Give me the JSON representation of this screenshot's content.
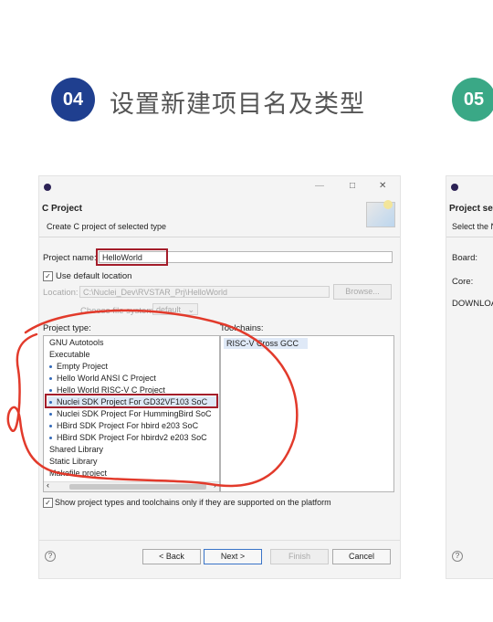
{
  "colors": {
    "step4_circle": "#1f3f8f",
    "step5_circle": "#3aa886",
    "annotation_red": "#e23a2b",
    "highlight_box": "#a41d2a"
  },
  "header": {
    "step_number": "04",
    "step_title": "设置新建项目名及类型",
    "next_step_number": "05"
  },
  "dialog": {
    "app_icon": "eclipse-icon",
    "window_controls": [
      "—",
      "□",
      "✕"
    ],
    "title": "C Project",
    "subtitle": "Create C project of selected type",
    "project_name_label": "Project name:",
    "project_name_value": "HelloWorld",
    "use_default_location_label": "Use default location",
    "use_default_location_checked": true,
    "location_label": "Location:",
    "location_value": "C:\\Nuclei_Dev\\RVSTAR_Prj\\HelloWorld",
    "browse_label": "Browse...",
    "file_system_label": "Choose file system:",
    "file_system_value": "default",
    "project_type_label": "Project type:",
    "toolchains_label": "Toolchains:",
    "project_types": [
      {
        "label": "GNU Autotools",
        "bullet": false
      },
      {
        "label": "Executable",
        "bullet": false
      },
      {
        "label": "Empty Project",
        "bullet": true
      },
      {
        "label": "Hello World ANSI C Project",
        "bullet": true
      },
      {
        "label": "Hello World RISC-V C Project",
        "bullet": true
      },
      {
        "label": "Nuclei SDK Project For GD32VF103 SoC",
        "bullet": true,
        "selected": true
      },
      {
        "label": "Nuclei SDK Project For HummingBird SoC",
        "bullet": true
      },
      {
        "label": "HBird SDK Project For hbird e203 SoC",
        "bullet": true
      },
      {
        "label": "HBird SDK Project For hbirdv2 e203 SoC",
        "bullet": true
      },
      {
        "label": "Shared Library",
        "bullet": false
      },
      {
        "label": "Static Library",
        "bullet": false
      },
      {
        "label": "Makefile project",
        "bullet": false
      }
    ],
    "toolchains": [
      "RISC-V Cross GCC"
    ],
    "show_supported_label": "Show project types and toolchains only if they are supported on the platform",
    "show_supported_checked": true,
    "buttons": {
      "help": "?",
      "back": "< Back",
      "next": "Next >",
      "finish": "Finish",
      "cancel": "Cancel"
    }
  },
  "dialog2": {
    "title": "Project set",
    "subtitle": "Select the N",
    "fields": [
      "Board:",
      "Core:",
      "DOWNLOA"
    ],
    "help": "?"
  }
}
